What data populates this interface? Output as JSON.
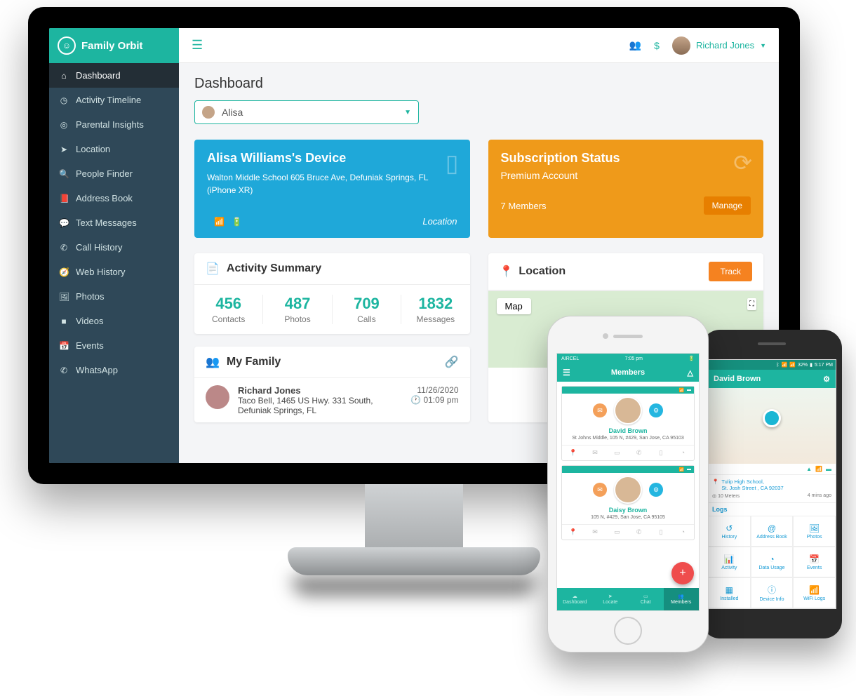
{
  "brand": {
    "name": "Family Orbit"
  },
  "topbar": {
    "user_name": "Richard Jones"
  },
  "sidebar": {
    "items": [
      {
        "label": "Dashboard",
        "icon": "⌂",
        "active": true
      },
      {
        "label": "Activity Timeline",
        "icon": "◷"
      },
      {
        "label": "Parental Insights",
        "icon": "◎"
      },
      {
        "label": "Location",
        "icon": "➤"
      },
      {
        "label": "People Finder",
        "icon": "🔍"
      },
      {
        "label": "Address Book",
        "icon": "📕"
      },
      {
        "label": "Text Messages",
        "icon": "💬"
      },
      {
        "label": "Call History",
        "icon": "✆"
      },
      {
        "label": "Web History",
        "icon": "🧭"
      },
      {
        "label": "Photos",
        "icon": "🖼"
      },
      {
        "label": "Videos",
        "icon": "■"
      },
      {
        "label": "Events",
        "icon": "📅"
      },
      {
        "label": "WhatsApp",
        "icon": "✆"
      }
    ]
  },
  "page": {
    "title": "Dashboard",
    "selected_child": "Alisa"
  },
  "device": {
    "title": "Alisa Williams's Device",
    "address": "Walton Middle School 605 Bruce Ave, Defuniak Springs, FL",
    "model": "(iPhone XR)",
    "foot_label": "Location"
  },
  "subscription": {
    "title": "Subscription Status",
    "plan": "Premium Account",
    "members": "7 Members",
    "manage": "Manage"
  },
  "activity": {
    "title": "Activity Summary",
    "stats": [
      {
        "num": "456",
        "label": "Contacts"
      },
      {
        "num": "487",
        "label": "Photos"
      },
      {
        "num": "709",
        "label": "Calls"
      },
      {
        "num": "1832",
        "label": "Messages"
      }
    ]
  },
  "location_widget": {
    "title": "Location",
    "track": "Track",
    "map_toggle": "Map"
  },
  "family": {
    "title": "My Family",
    "rows": [
      {
        "name": "Richard Jones",
        "address": "Taco Bell, 1465 US Hwy. 331 South, Defuniak Springs, FL",
        "date": "11/26/2020",
        "time": "01:09 pm"
      }
    ]
  },
  "iphone": {
    "status_time": "7:05 pm",
    "carrier": "AIRCEL",
    "header": "Members",
    "members": [
      {
        "name": "David Brown",
        "address": "St Johns Middle, 105 N, #429, San Jose, CA 95103"
      },
      {
        "name": "Daisy Brown",
        "address": "105 N, #429, San Jose, CA 95105"
      }
    ],
    "tabs": [
      {
        "label": "Dashboard",
        "icon": "☁"
      },
      {
        "label": "Locate",
        "icon": "➤"
      },
      {
        "label": "Chat",
        "icon": "▭"
      },
      {
        "label": "Members",
        "icon": "👥"
      }
    ]
  },
  "android": {
    "status_time": "5:17 PM",
    "battery": "32%",
    "header": "David Brown",
    "loc_line1": "Tulip High School,",
    "loc_line2": "St. Josh Street , CA 92037",
    "distance": "10 Meters",
    "ago": "4 mins ago",
    "logs_title": "Logs",
    "grid": [
      {
        "label": "History",
        "icon": "↺"
      },
      {
        "label": "Address Book",
        "icon": "@"
      },
      {
        "label": "Photos",
        "icon": "🖼"
      },
      {
        "label": "Activity",
        "icon": "📊"
      },
      {
        "label": "Data Usage",
        "icon": "◔"
      },
      {
        "label": "Events",
        "icon": "📅"
      },
      {
        "label": "Installed",
        "icon": "▦"
      },
      {
        "label": "Device Info",
        "icon": "ⓘ"
      },
      {
        "label": "WiFi Logs",
        "icon": "📶"
      }
    ]
  }
}
